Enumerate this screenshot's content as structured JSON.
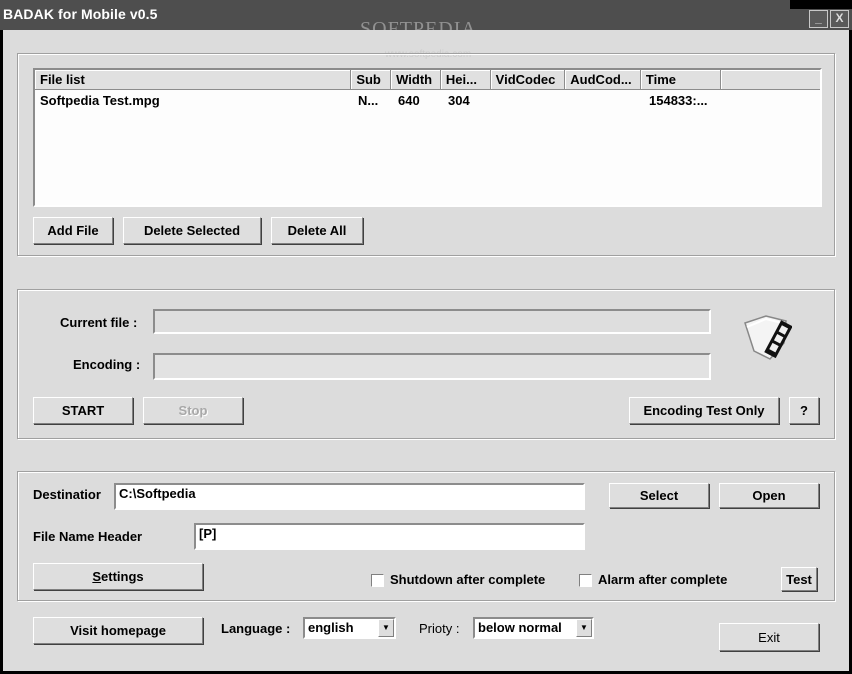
{
  "window": {
    "title": "BADAK for Mobile v0.5",
    "minimize_label": "_",
    "close_label": "X",
    "watermark": "SOFTPEDIA",
    "watermark_url": "www.softpedia.com"
  },
  "file_list": {
    "columns": [
      "File list",
      "Sub",
      "Width",
      "Hei...",
      "VidCodec",
      "AudCod...",
      "Time",
      ""
    ],
    "rows": [
      [
        "Softpedia Test.mpg",
        "N...",
        "640",
        "304",
        "",
        "",
        "154833:..."
      ]
    ],
    "buttons": {
      "add_file": "Add File",
      "delete_selected": "Delete Selected",
      "delete_all": "Delete All"
    }
  },
  "encoding": {
    "current_file_label": "Current file :",
    "current_file_value": "",
    "encoding_label": "Encoding :",
    "encoding_progress": 0,
    "start_label": "START",
    "stop_label": "Stop",
    "encoding_test_label": "Encoding Test Only",
    "help_label": "?",
    "icon": "film-icon"
  },
  "output": {
    "destination_label": "Destinatior",
    "destination_value": "C:\\Softpedia",
    "file_name_header_label": "File Name Header",
    "file_name_header_value": "[P]",
    "select_label": "Select",
    "open_label": "Open",
    "settings_label_first": "S",
    "settings_label_rest": "ettings",
    "shutdown_label": "Shutdown after complete",
    "shutdown_checked": false,
    "alarm_label": "Alarm after complete",
    "alarm_checked": false,
    "test_label": "Test"
  },
  "footer": {
    "visit_homepage_label": "Visit homepage",
    "language_label": "Language :",
    "language_value": "english",
    "priority_label": "Prioty :",
    "priority_value": "below normal",
    "exit_label": "Exit"
  }
}
